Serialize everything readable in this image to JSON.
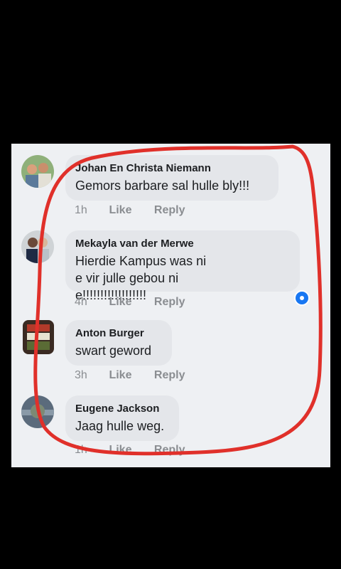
{
  "comments": [
    {
      "name": "Johan En Christa Niemann",
      "text": "Gemors barbare sal hulle bly!!!",
      "time": "1h",
      "like": "Like",
      "reply": "Reply"
    },
    {
      "name": "Mekayla van der Merwe",
      "text": "Hierdie Kampus was nie vir julle gebou nie!!!!!!!!!!!!!!!!!!",
      "time": "4h",
      "like": "Like",
      "reply": "Reply"
    },
    {
      "name": "Anton Burger",
      "text": "swart geword",
      "time": "3h",
      "like": "Like",
      "reply": "Reply"
    },
    {
      "name": "Eugene Jackson",
      "text": "Jaag hulle weg.",
      "time": "1h",
      "like": "Like",
      "reply": "Reply"
    }
  ],
  "colors": {
    "background": "#000000",
    "panel": "#eef0f3",
    "bubble": "#e4e6ea",
    "annotation": "#e0302a",
    "reaction": "#1877f2"
  },
  "icons": {
    "reaction": "like-reaction-icon"
  }
}
